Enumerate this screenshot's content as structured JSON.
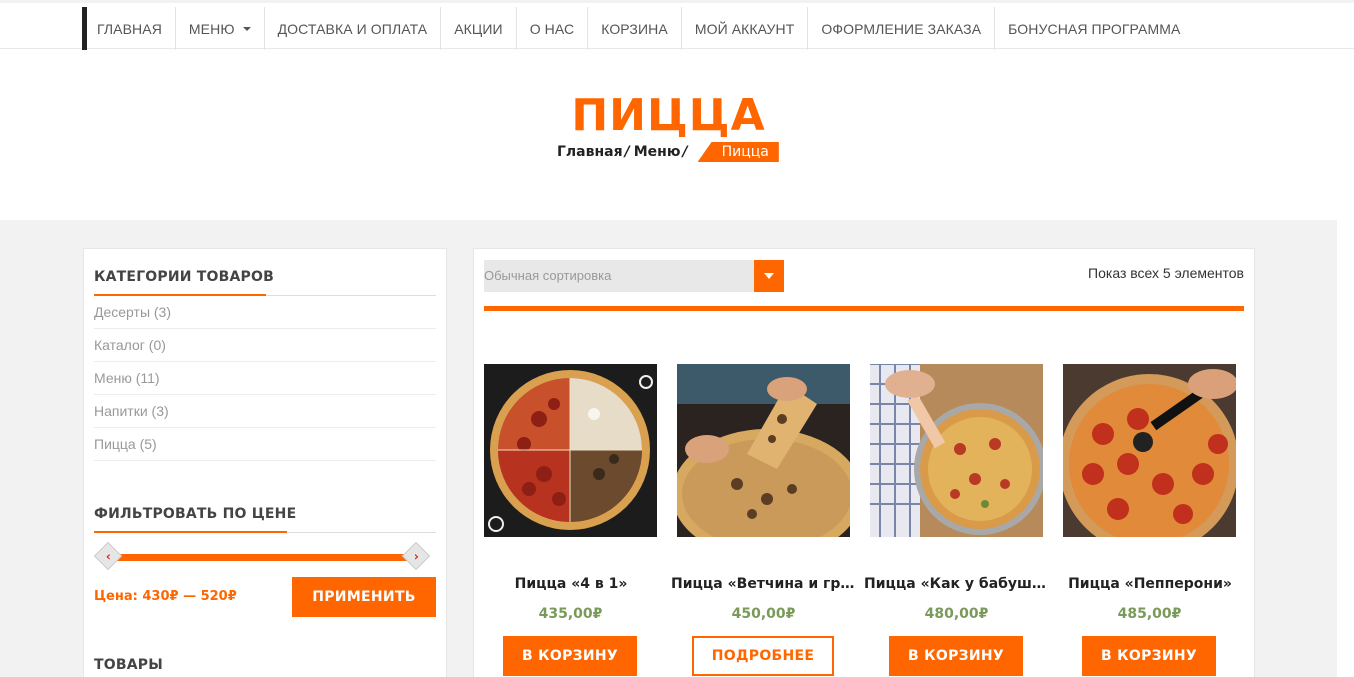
{
  "nav": {
    "items": [
      {
        "label": "ГЛАВНАЯ"
      },
      {
        "label": "МЕНЮ"
      },
      {
        "label": "ДОСТАВКА И ОПЛАТА"
      },
      {
        "label": "АКЦИИ"
      },
      {
        "label": "О НАС"
      },
      {
        "label": "КОРЗИНА"
      },
      {
        "label": "МОЙ АККАУНТ"
      },
      {
        "label": "ОФОРМЛЕНИЕ ЗАКАЗА"
      },
      {
        "label": "БОНУСНАЯ ПРОГРАММА"
      }
    ]
  },
  "hero": {
    "title": "ПИЦЦА",
    "breadcrumb": [
      "Главная",
      "Меню",
      "Пицца"
    ],
    "separator": "/"
  },
  "sidebar": {
    "categories_title": "КАТЕГОРИИ ТОВАРОВ",
    "categories": [
      {
        "label": "Десерты (3)"
      },
      {
        "label": "Каталог (0)"
      },
      {
        "label": "Меню (11)"
      },
      {
        "label": "Напитки (3)"
      },
      {
        "label": "Пицца (5)"
      }
    ],
    "filter_title": "ФИЛЬТРОВАТЬ ПО ЦЕНЕ",
    "price_text": "Цена: 430₽ — 520₽",
    "apply_label": "ПРИМЕНИТЬ",
    "products_title": "ТОВАРЫ"
  },
  "shop": {
    "sort_value": "Обычная сортировка",
    "result_count": "Показ всех 5 элементов",
    "products": [
      {
        "name": "Пицца «4 в 1»",
        "price": "435,00₽",
        "button": "В КОРЗИНУ",
        "style": "fill"
      },
      {
        "name": "Пицца «Ветчина и грибы»",
        "price": "450,00₽",
        "button": "ПОДРОБНЕЕ",
        "style": "outline"
      },
      {
        "name": "Пицца «Как у бабушки»",
        "price": "480,00₽",
        "button": "В КОРЗИНУ",
        "style": "fill"
      },
      {
        "name": "Пицца «Пепперони»",
        "price": "485,00₽",
        "button": "В КОРЗИНУ",
        "style": "fill"
      }
    ]
  },
  "colors": {
    "accent": "#ff6600",
    "price": "#7a9a5a",
    "band": "#f2f2f2"
  }
}
